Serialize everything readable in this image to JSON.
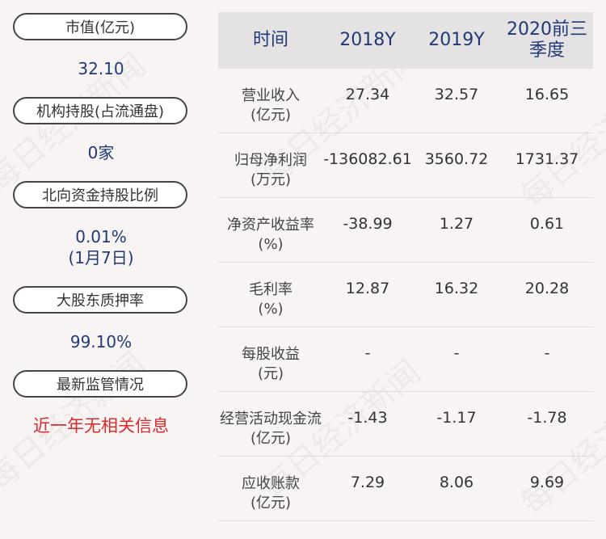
{
  "left_panel": [
    {
      "label": "市值(亿元)",
      "value": "32.10"
    },
    {
      "label": "机构持股(占流通盘)",
      "value": "0家"
    },
    {
      "label": "北向资金持股比例",
      "value": "0.01%",
      "value2": "(1月7日)"
    },
    {
      "label": "大股东质押率",
      "value": "99.10%"
    },
    {
      "label": "最新监管情况",
      "value": "近一年无相关信息"
    }
  ],
  "table": {
    "headers": [
      "时间",
      "2018Y",
      "2019Y",
      "2020前三季度"
    ],
    "header_last_line1": "2020前三",
    "header_last_line2": "季度",
    "rows": [
      {
        "label1": "营业收入",
        "label2": "(亿元)",
        "values": [
          "27.34",
          "32.57",
          "16.65"
        ]
      },
      {
        "label1": "归母净利润",
        "label2": "(万元)",
        "values": [
          "-136082.61",
          "3560.72",
          "1731.37"
        ]
      },
      {
        "label1": "净资产收益率",
        "label2": "(%)",
        "values": [
          "-38.99",
          "1.27",
          "0.61"
        ]
      },
      {
        "label1": "毛利率",
        "label2": "(%)",
        "values": [
          "12.87",
          "16.32",
          "20.28"
        ]
      },
      {
        "label1": "每股收益",
        "label2": "(元)",
        "values": [
          "-",
          "-",
          "-"
        ]
      },
      {
        "label1": "经营活动现金流",
        "label2": "(亿元)",
        "values": [
          "-1.43",
          "-1.17",
          "-1.78"
        ]
      },
      {
        "label1": "应收账款",
        "label2": "(亿元)",
        "values": [
          "7.29",
          "8.06",
          "9.69"
        ]
      }
    ]
  },
  "watermark": "每日经济新闻",
  "colors": {
    "value_blue": "#1f3a77",
    "alert_red": "#d92b2b",
    "header_bg": "#e5e2e4"
  }
}
